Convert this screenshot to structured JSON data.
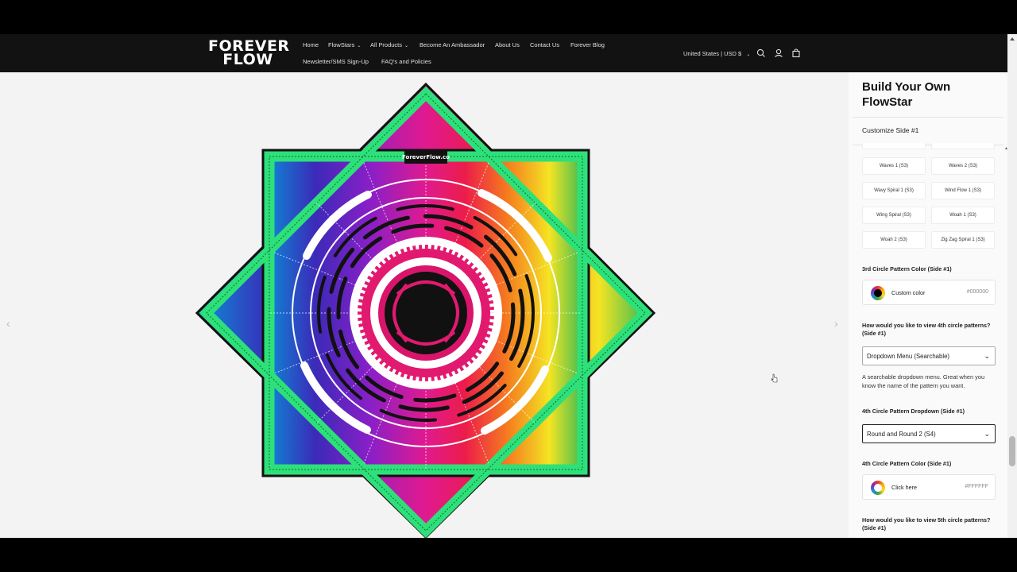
{
  "brand": {
    "logo_line1": "FOREVER",
    "logo_line2": "FLOW"
  },
  "nav": {
    "home": "Home",
    "flowstars": "FlowStars",
    "all_products": "All Products",
    "ambassador": "Become An Ambassador",
    "about": "About Us",
    "contact": "Contact Us",
    "blog": "Forever Blog",
    "newsletter": "Newsletter/SMS Sign-Up",
    "faq": "FAQ's and Policies"
  },
  "header": {
    "locale": "United States | USD $",
    "icons": [
      "search-icon",
      "account-icon",
      "cart-icon"
    ]
  },
  "product_image": {
    "watermark": "ForeverFlow.co"
  },
  "sidebar": {
    "title": "Build Your Own FlowStar",
    "section": "Customize Side #1",
    "patterns": [
      "Waves 1 (S3)",
      "Waves 2 (S3)",
      "Wavy Spiral 1 (S3)",
      "Wind Flow 1 (S3)",
      "Wing Spiral (S3)",
      "Woah 1 (S3)",
      "Woah 2 (S3)",
      "Zig Zag Spiral 1 (S3)"
    ],
    "color3_label": "3rd Circle Pattern Color (Side #1)",
    "color3_name": "Custom color",
    "color3_hex": "#000000",
    "view4_label": "How would you like to view 4th circle patterns? (Side #1)",
    "view4_value": "Dropdown Menu (Searchable)",
    "view4_help": "A searchable dropdown menu. Great when you know the name of the pattern you want.",
    "dropdown4_label": "4th Circle Pattern Dropdown (Side #1)",
    "dropdown4_value": "Round and Round 2 (S4)",
    "color4_label": "4th Circle Pattern Color (Side #1)",
    "color4_name": "Click here",
    "color4_hex": "#FFFFFF",
    "view5_label": "How would you like to view 5th circle patterns? (Side #1)"
  },
  "colors": {
    "header_bg": "#121212",
    "page_bg": "#f3f3f3",
    "frame_green": "#2ee07a"
  }
}
